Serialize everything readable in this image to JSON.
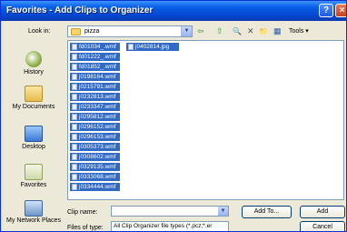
{
  "window": {
    "title": "Favorites - Add Clips to Organizer"
  },
  "titlebar_buttons": {
    "help": "?",
    "close": "×"
  },
  "toolbar": {
    "look_in_label": "Look in:",
    "look_in_value": "pizza",
    "dropdown_arrow": "▼",
    "back_icon": "⇦",
    "up_icon": "⇧",
    "search_icon": "🔍",
    "delete_icon": "✕",
    "new_folder_icon": "📁",
    "views_icon": "▦",
    "tools_label": "Tools ▾"
  },
  "places": [
    {
      "label": "History",
      "icon": "history-icon"
    },
    {
      "label": "My Documents",
      "icon": "my-documents-icon"
    },
    {
      "label": "Desktop",
      "icon": "desktop-icon"
    },
    {
      "label": "Favorites",
      "icon": "favorites-icon"
    },
    {
      "label": "My Network Places",
      "icon": "network-places-icon"
    }
  ],
  "files": {
    "column1": [
      "fd01034_.wmf",
      "fd01222_.wmf",
      "fd01852_.wmf",
      "j0198164.wmf",
      "j0215791.wmf",
      "j0232813.wmf",
      "j0233347.wmf",
      "j0295812.wmf",
      "j0296152.wmf",
      "j0296153.wmf",
      "j0305373.wmf",
      "j0308602.wmf",
      "j0329135.wmf",
      "j0333068.wmf",
      "j0334444.wmf"
    ],
    "column2": [
      "j0402814.jpg"
    ]
  },
  "footer": {
    "clip_name_label": "Clip name:",
    "clip_name_value": "",
    "files_of_type_label": "Files of type:",
    "files_of_type_value": "All Clip Organizer file types (*.pcz;*.er",
    "add_to_label": "Add To...",
    "add_label": "Add",
    "cancel_label": "Cancel"
  }
}
